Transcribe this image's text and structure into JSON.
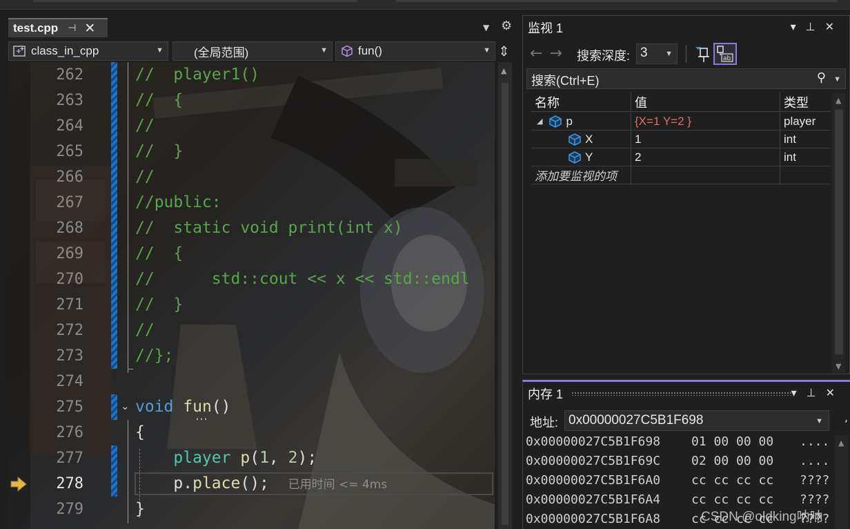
{
  "editor": {
    "tab": {
      "name": "test.cpp",
      "pin": "⊣",
      "close": "✕"
    },
    "nav": {
      "project": "class_in_cpp",
      "scope": "(全局范围)",
      "member": "fun()"
    },
    "lines": [
      {
        "num": "262"
      },
      {
        "num": "263"
      },
      {
        "num": "264"
      },
      {
        "num": "265"
      },
      {
        "num": "266"
      },
      {
        "num": "267"
      },
      {
        "num": "268"
      },
      {
        "num": "269"
      },
      {
        "num": "270"
      },
      {
        "num": "271"
      },
      {
        "num": "272"
      },
      {
        "num": "273"
      },
      {
        "num": "274"
      },
      {
        "num": "275"
      },
      {
        "num": "276"
      },
      {
        "num": "277"
      },
      {
        "num": "278"
      },
      {
        "num": "279"
      }
    ],
    "code": {
      "l262": "//  player1()",
      "l263": "//  {",
      "l264": "//",
      "l265": "//  }",
      "l266": "//",
      "l267": "//public:",
      "l268": "//  static void print(int x)",
      "l269": "//  {",
      "l270": "//      std::cout << x << std::endl",
      "l271": "//  }",
      "l272": "//",
      "l273": "//};",
      "l275_kw": "void",
      "l275_fn": "fun",
      "l275_rest": "()",
      "l276": "{",
      "l277_ty": "player",
      "l277_fn": "p",
      "l277_a": "(",
      "l277_n1": "1",
      "l277_b": ", ",
      "l277_n2": "2",
      "l277_c": ");",
      "l278_a": "p.",
      "l278_fn": "place",
      "l278_b": "();",
      "l278_hint": "已用时间 <= 4ms",
      "l279": "}"
    },
    "fold_dots": "…"
  },
  "watch": {
    "title": "监视 1",
    "depth_label": "搜索深度:",
    "depth_value": "3",
    "search_placeholder": "搜索(Ctrl+E)",
    "columns": {
      "name": "名称",
      "value": "值",
      "type": "类型"
    },
    "rows": [
      {
        "name": "p",
        "value": "{X=1 Y=2 }",
        "type": "player"
      },
      {
        "name": "X",
        "value": "1",
        "type": "int"
      },
      {
        "name": "Y",
        "value": "2",
        "type": "int"
      }
    ],
    "add_item": "添加要监视的项"
  },
  "memory": {
    "title": "内存 1",
    "address_label": "地址:",
    "address_value": "0x00000027C5B1F698",
    "rows": [
      {
        "addr": "0x00000027C5B1F698",
        "bytes": "01 00 00 00",
        "ascii": "...."
      },
      {
        "addr": "0x00000027C5B1F69C",
        "bytes": "02 00 00 00",
        "ascii": "...."
      },
      {
        "addr": "0x00000027C5B1F6A0",
        "bytes": "cc cc cc cc",
        "ascii": "????"
      },
      {
        "addr": "0x00000027C5B1F6A4",
        "bytes": "cc cc cc cc",
        "ascii": "????"
      },
      {
        "addr": "0x00000027C5B1F6A8",
        "bytes": "cc cc cc cc",
        "ascii": "????"
      }
    ]
  },
  "watermark": "CSDN @oldking呐呐",
  "colors": {
    "comment": "#57a64a",
    "keyword": "#569cd6",
    "function": "#dcdcaa",
    "type": "#4ec9b0",
    "accent": "#8a7cd8",
    "change_bar": "#1e72c9"
  }
}
